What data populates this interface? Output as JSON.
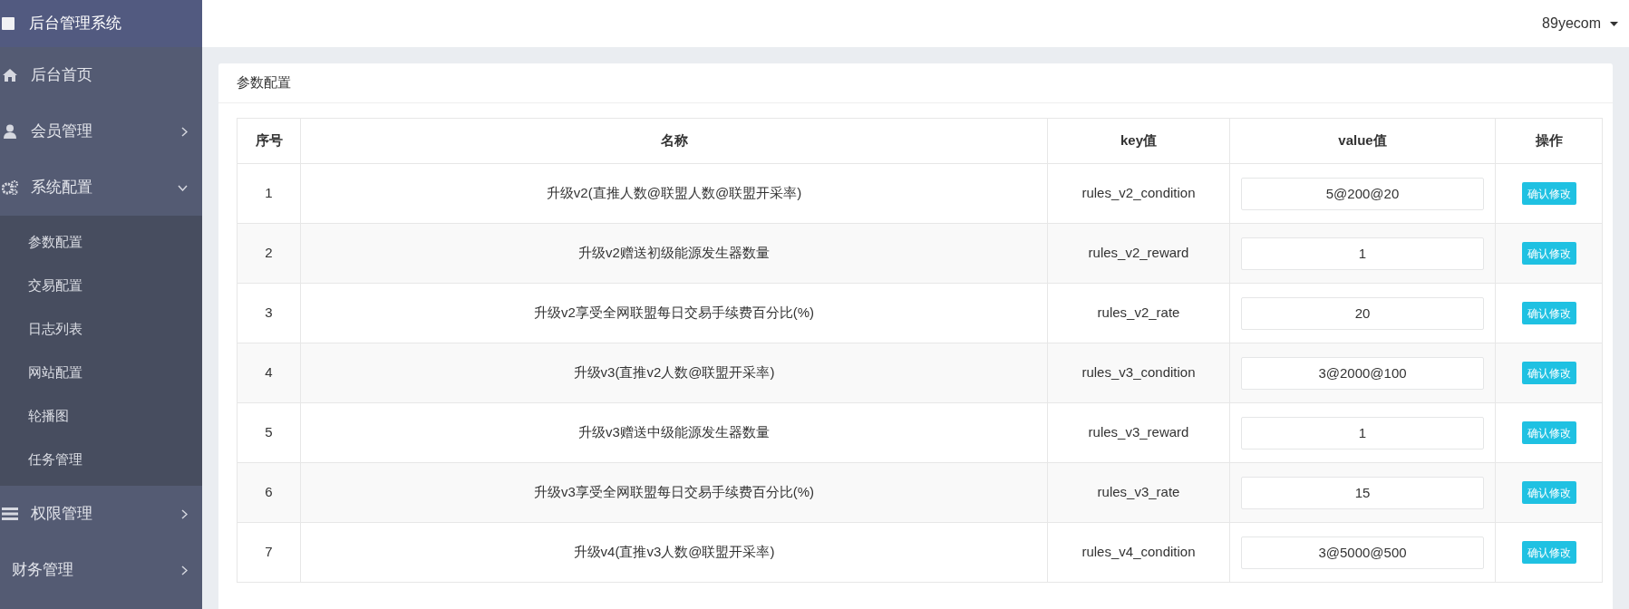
{
  "sidebar": {
    "title": "后台管理系统",
    "items": [
      {
        "label": "后台首页",
        "expandable": false,
        "expanded": false
      },
      {
        "label": "会员管理",
        "expandable": true,
        "expanded": false
      },
      {
        "label": "系统配置",
        "expandable": true,
        "expanded": true,
        "children": [
          {
            "label": "参数配置"
          },
          {
            "label": "交易配置"
          },
          {
            "label": "日志列表"
          },
          {
            "label": "网站配置"
          },
          {
            "label": "轮播图"
          },
          {
            "label": "任务管理"
          }
        ]
      },
      {
        "label": "权限管理",
        "expandable": true,
        "expanded": false
      },
      {
        "label": "财务管理",
        "expandable": true,
        "expanded": false
      }
    ]
  },
  "top_bar": {
    "user": "89yecom"
  },
  "panel": {
    "title": "参数配置",
    "table": {
      "columns": [
        "序号",
        "名称",
        "key值",
        "value值",
        "操作"
      ],
      "rows": [
        {
          "index": "1",
          "name": "升级v2(直推人数@联盟人数@联盟开采率)",
          "key": "rules_v2_condition",
          "value": "5@200@20",
          "action": "确认修改"
        },
        {
          "index": "2",
          "name": "升级v2赠送初级能源发生器数量",
          "key": "rules_v2_reward",
          "value": "1",
          "action": "确认修改"
        },
        {
          "index": "3",
          "name": "升级v2享受全网联盟每日交易手续费百分比(%)",
          "key": "rules_v2_rate",
          "value": "20",
          "action": "确认修改"
        },
        {
          "index": "4",
          "name": "升级v3(直推v2人数@联盟开采率)",
          "key": "rules_v3_condition",
          "value": "3@2000@100",
          "action": "确认修改"
        },
        {
          "index": "5",
          "name": "升级v3赠送中级能源发生器数量",
          "key": "rules_v3_reward",
          "value": "1",
          "action": "确认修改"
        },
        {
          "index": "6",
          "name": "升级v3享受全网联盟每日交易手续费百分比(%)",
          "key": "rules_v3_rate",
          "value": "15",
          "action": "确认修改"
        },
        {
          "index": "7",
          "name": "升级v4(直推v3人数@联盟开采率)",
          "key": "rules_v4_condition",
          "value": "3@5000@500",
          "action": "确认修改"
        }
      ]
    }
  }
}
